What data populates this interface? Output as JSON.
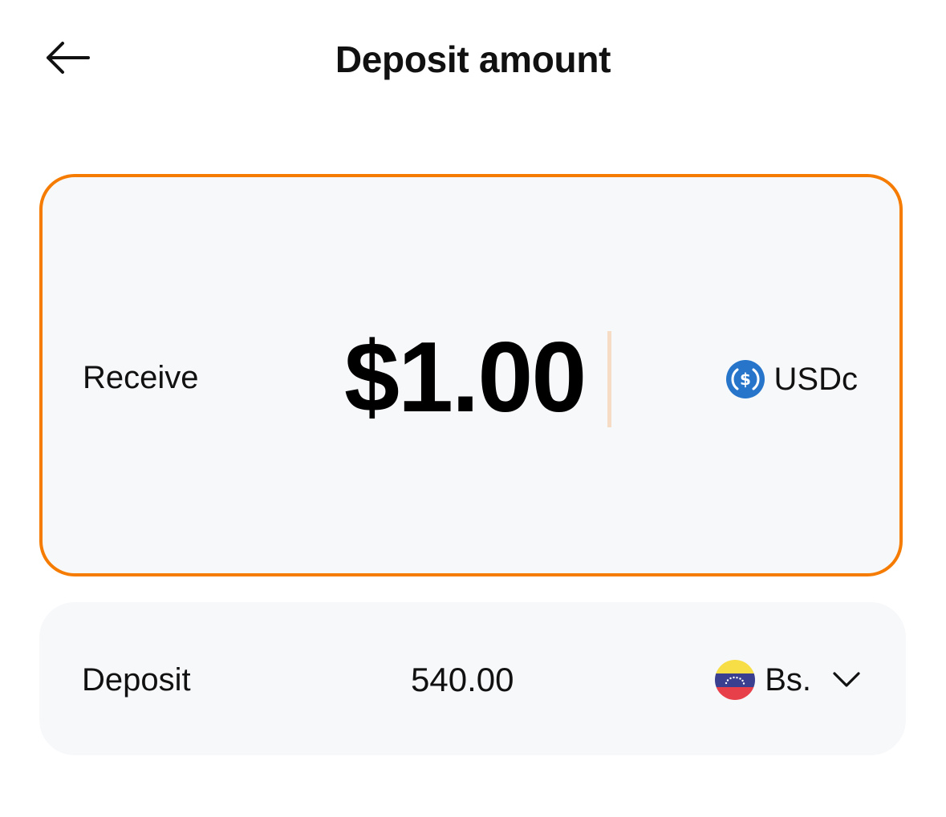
{
  "header": {
    "title": "Deposit amount",
    "back_icon": "arrow-left-icon"
  },
  "receive": {
    "label": "Receive",
    "amount": "$1.00",
    "currency": "USDc",
    "currency_icon": "usdc-coin-icon",
    "accent_color": "#f57c00"
  },
  "deposit": {
    "label": "Deposit",
    "amount": "540.00",
    "currency": "Bs.",
    "flag_icon": "venezuela-flag-icon",
    "dropdown_icon": "chevron-down-icon"
  }
}
